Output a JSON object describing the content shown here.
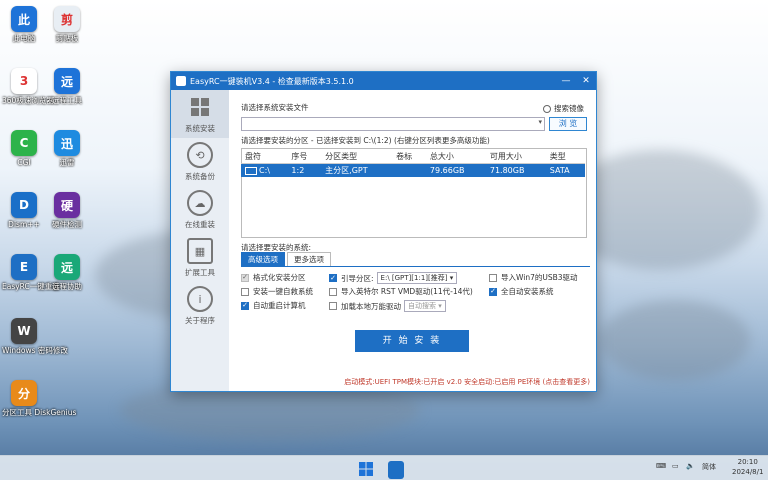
{
  "desktop": {
    "icons": [
      {
        "label": "此电脑",
        "icon": "computer-icon",
        "color": "#1e73d8"
      },
      {
        "label": "剪贴板",
        "icon": "clipboard-icon",
        "color": "#e8eef4"
      },
      {
        "label": "360极速浏览器",
        "icon": "browser-icon",
        "color": "#ffffff"
      },
      {
        "label": "远程工具",
        "icon": "remote-tool-icon",
        "color": "#1e73d8"
      },
      {
        "label": "CGI",
        "icon": "cgi-icon",
        "color": "#2db34a"
      },
      {
        "label": "迅雷",
        "icon": "thunder-icon",
        "color": "#1e8be0"
      },
      {
        "label": "Dism++",
        "icon": "dism-icon",
        "color": "#1a6fc8"
      },
      {
        "label": "硬件检测",
        "icon": "hardware-icon",
        "color": "#6a2fa0"
      },
      {
        "label": "EasyRC一键重装",
        "icon": "easyrc-icon",
        "color": "#1e6fc4"
      },
      {
        "label": "远程协助",
        "icon": "remote-assist-icon",
        "color": "#1aa878"
      },
      {
        "label": "Windows 密码修改",
        "icon": "key-icon",
        "color": "#444444"
      },
      {
        "label": "分区工具 DiskGenius",
        "icon": "diskgenius-icon",
        "color": "#e88a1a"
      }
    ]
  },
  "window": {
    "title": "EasyRC一键装机V3.4 - 检查最新版本3.5.1.0",
    "controls": {
      "minimize": "—",
      "close": "✕"
    }
  },
  "sidebar": {
    "items": [
      {
        "label": "系统安装",
        "icon": "windows-icon"
      },
      {
        "label": "系统备份",
        "icon": "backup-icon"
      },
      {
        "label": "在线重装",
        "icon": "cloud-icon"
      },
      {
        "label": "扩展工具",
        "icon": "tools-icon"
      },
      {
        "label": "关于程序",
        "icon": "info-icon"
      }
    ]
  },
  "main": {
    "select_file_label": "请选择系统安装文件",
    "search_image_label": "搜索镜像",
    "file_value": "",
    "browse_label": "浏 览",
    "partition_prompt": "请选择要安装的分区 - 已选择安装到 C:\\(1:2) (右键分区列表更多高级功能)",
    "table": {
      "headers": [
        "盘符",
        "序号",
        "分区类型",
        "卷标",
        "总大小",
        "可用大小",
        "类型"
      ],
      "rows": [
        [
          "C:\\",
          "1:2",
          "主分区,GPT",
          "",
          "79.66GB",
          "71.80GB",
          "SATA"
        ]
      ]
    },
    "system_prompt": "请选择要安装的系统:",
    "tabs": [
      "高级选项",
      "更多选项"
    ],
    "options": {
      "format": "格式化安装分区",
      "boot_partition": "引导分区:",
      "boot_value": "E:\\ [GPT][1:1][推荐]",
      "usb3": "导入Win7的USB3驱动",
      "one_key": "安装一键自救系统",
      "intel": "导入英特尔 RST VMD驱动(11代-14代)",
      "auto_install": "全自动安装系统",
      "reboot": "自动重启计算机",
      "universal_driver": "加载本地万能驱动",
      "driver_mode": "自动搜索"
    },
    "start_button": "开 始 安 装",
    "status": "启动模式:UEFI  TPM模块:已开启  v2.0  安全启动:已启用  PE环境 (点击查看更多)"
  },
  "taskbar": {
    "lang": "简体",
    "time": "20:10",
    "date": "2024/8/1"
  }
}
